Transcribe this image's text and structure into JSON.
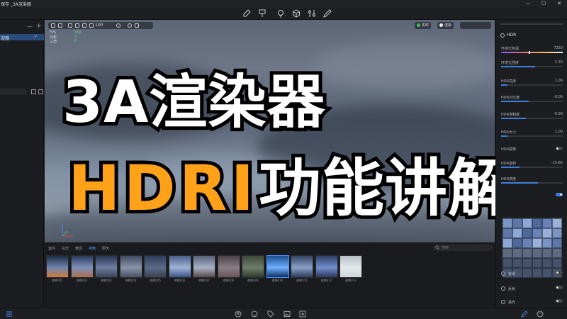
{
  "window": {
    "title": "保存 _3A渲染器",
    "controls": [
      "—",
      "☐",
      "✕"
    ]
  },
  "toolbar": {
    "icons": [
      "picker-icon",
      "brush-icon",
      "bulb-icon",
      "cube-icon",
      "adjust-icon",
      "eyedropper-icon"
    ]
  },
  "left_panel": {
    "item_label": "渲器",
    "item_check": "✓",
    "minus": "—",
    "plus": "+"
  },
  "viewport": {
    "zoom": "100",
    "stats": [
      {
        "label": "FPS",
        "value": "360"
      },
      {
        "label": "对象",
        "value": "0"
      },
      {
        "label": "三角",
        "value": "0"
      }
    ],
    "realtime_label": "实时",
    "render_label": "渲染"
  },
  "overlay": {
    "line1": "3A渲染器",
    "line2_accent": "HDRI",
    "line2_rest": "功能讲解"
  },
  "library": {
    "tabs": [
      {
        "label": "室内",
        "active": false
      },
      {
        "label": "白天",
        "active": false
      },
      {
        "label": "黄昏",
        "active": false
      },
      {
        "label": "夜晚",
        "active": true
      },
      {
        "label": "阴天",
        "active": false
      }
    ],
    "search_placeholder": "搜索",
    "thumbnails": [
      {
        "label": "夜晚001",
        "colors": [
          "#1d2a44",
          "#6d85b0",
          "#d07a38"
        ],
        "selected": false
      },
      {
        "label": "夜晚002",
        "colors": [
          "#2a3a5c",
          "#7d93bc",
          "#ad6b4a"
        ],
        "selected": false
      },
      {
        "label": "夜晚003",
        "colors": [
          "#27344f",
          "#6e7fa2",
          "#3a4458"
        ],
        "selected": false
      },
      {
        "label": "夜晚004",
        "colors": [
          "#3f4b63",
          "#8894a8",
          "#4a5262"
        ],
        "selected": false
      },
      {
        "label": "夜晚005",
        "colors": [
          "#2f3e5b",
          "#5a6a88",
          "#3a4050"
        ],
        "selected": false
      },
      {
        "label": "夜晚006",
        "colors": [
          "#4b5f88",
          "#a0b4d8",
          "#3a5484"
        ],
        "selected": false
      },
      {
        "label": "夜晚007",
        "colors": [
          "#56617a",
          "#a7b2c6",
          "#5a4a4a"
        ],
        "selected": false
      },
      {
        "label": "夜晚008",
        "colors": [
          "#4a4347",
          "#8a7d84",
          "#6a5558"
        ],
        "selected": false
      },
      {
        "label": "夜晚009",
        "colors": [
          "#3d4a3a",
          "#6f7d6a",
          "#2f3a2c"
        ],
        "selected": false
      },
      {
        "label": "夜晚010",
        "colors": [
          "#1a4e8c",
          "#6fb0ff",
          "#0d2f5e"
        ],
        "selected": true
      },
      {
        "label": "夜晚011",
        "colors": [
          "#334466",
          "#8aa0c6",
          "#2b3a5a"
        ],
        "selected": false
      },
      {
        "label": "夜晚012",
        "colors": [
          "#2f3f66",
          "#6f8fca",
          "#2a3658"
        ],
        "selected": false
      },
      {
        "label": "夜晚013",
        "colors": [
          "#b8c0c8",
          "#e4e8ec",
          "#cfd6dc"
        ],
        "selected": false
      }
    ]
  },
  "right_panel": {
    "header": "HDR",
    "rows": [
      {
        "label": "环境光色温",
        "value": "7250",
        "fill": 0.45,
        "type": "gradient"
      },
      {
        "label": "环境光强度",
        "value": "2.33",
        "fill": 0.55,
        "type": "slider"
      },
      {
        "label": "HDR亮度",
        "value": "1.09",
        "fill": 0.1,
        "type": "slider"
      },
      {
        "label": "HDR对比度",
        "value": "-0.06",
        "fill": 0.45,
        "type": "slider"
      },
      {
        "label": "HDR饱和度",
        "value": "-0.26",
        "fill": 0.4,
        "type": "slider"
      },
      {
        "label": "HDR大小",
        "value": "1.00",
        "fill": 0.1,
        "type": "slider"
      },
      {
        "label": "HDR镜像",
        "value": "",
        "fill": 0,
        "type": "toggle-off"
      },
      {
        "label": "HDR旋转",
        "value": "-15.85",
        "fill": 0.3,
        "type": "slider"
      },
      {
        "label": "HDR高度",
        "value": "",
        "fill": 0.6,
        "type": "slider"
      },
      {
        "label": "",
        "value": "",
        "fill": 0,
        "type": "toggle-on"
      }
    ],
    "options": [
      {
        "label": "背景",
        "on": false
      },
      {
        "label": "反射",
        "on": false
      },
      {
        "label": "高光",
        "on": false
      }
    ]
  },
  "bottombar": {
    "icons": [
      "list-icon",
      "person-icon",
      "smile-icon",
      "tag-icon",
      "image-icon",
      "play-icon",
      "paint-icon",
      "palette-icon"
    ]
  }
}
